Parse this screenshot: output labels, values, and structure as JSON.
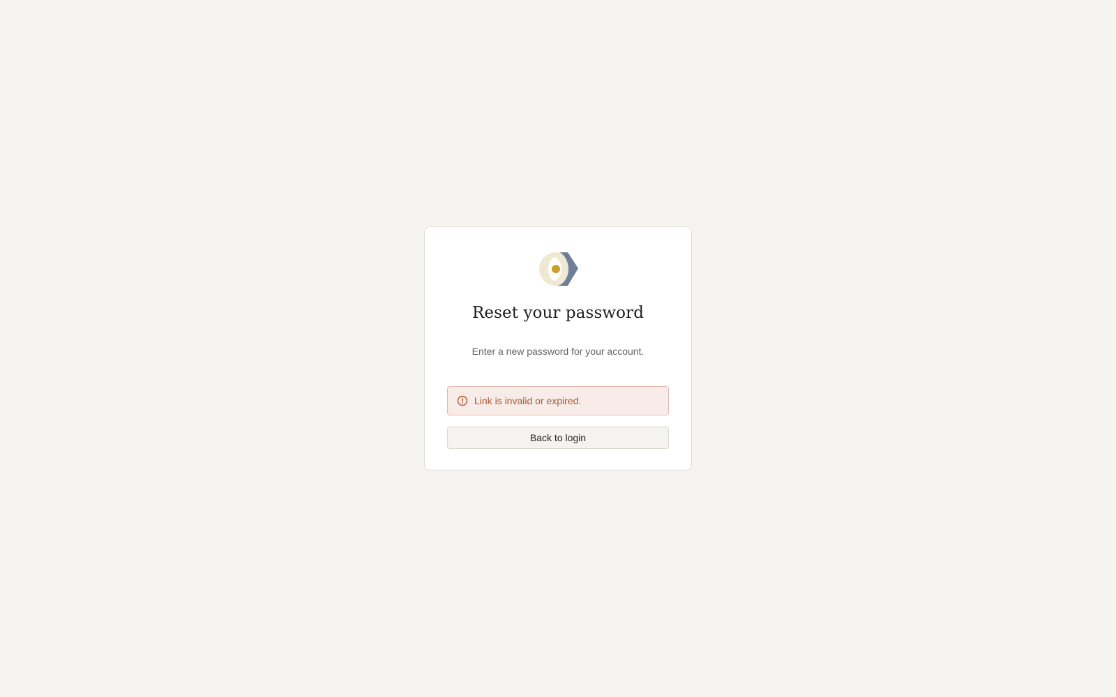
{
  "card": {
    "logo_icon": "app-logo-icon",
    "title": "Reset your password",
    "subtitle": "Enter a new password for your account.",
    "alert": {
      "icon": "alert-circle-icon",
      "message": "Link is invalid or expired.",
      "color": "#b0552f"
    },
    "back_button_label": "Back to login"
  },
  "colors": {
    "background": "#f6f4f0",
    "card": "#ffffff",
    "logo_slate": "#6f7f98",
    "logo_cream": "#efe9d4",
    "logo_gold": "#c9a12a",
    "alert_bg": "#f8ece8",
    "alert_border": "#e4b9ad"
  }
}
